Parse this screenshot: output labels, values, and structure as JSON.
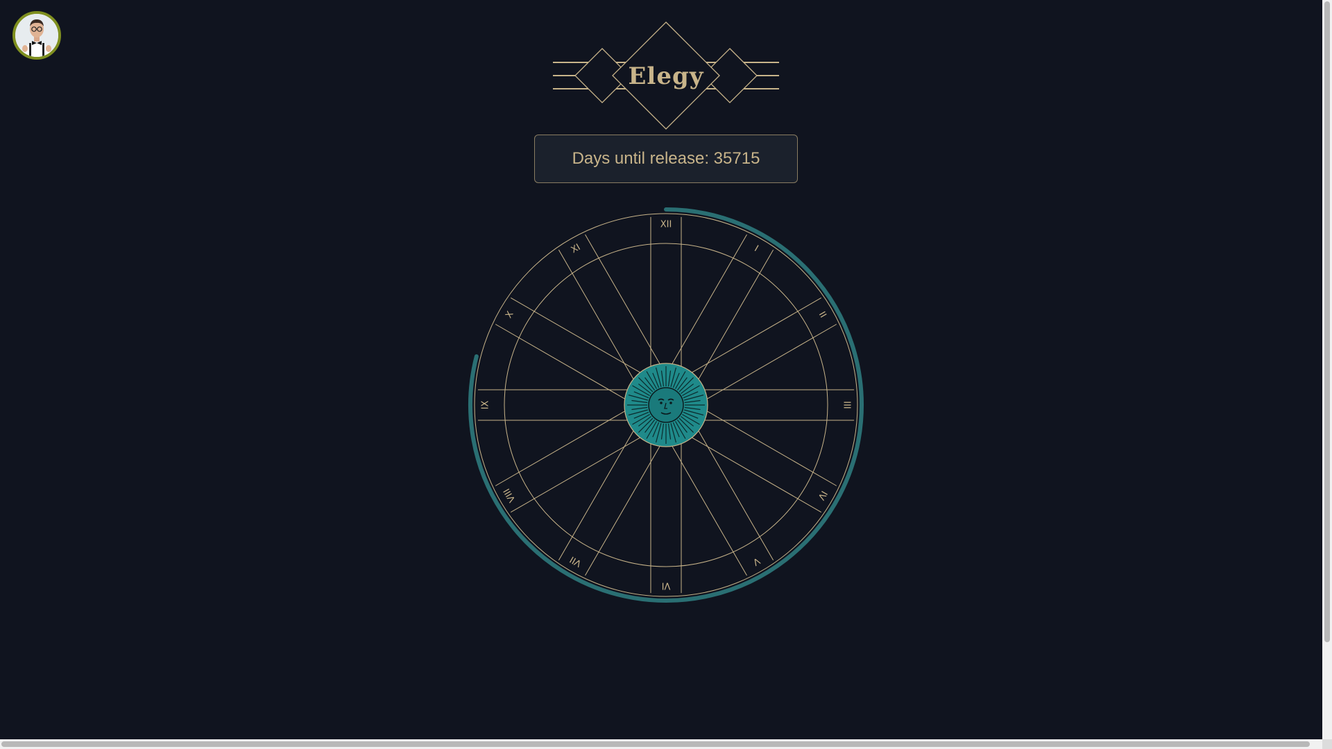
{
  "app": {
    "title": "Elegy"
  },
  "user": {
    "avatar_icon": "user-avatar-photo"
  },
  "countdown": {
    "label": "Days until release: 35715"
  },
  "clock": {
    "numerals": [
      "XII",
      "I",
      "II",
      "III",
      "IV",
      "V",
      "VI",
      "VII",
      "VIII",
      "IX",
      "X",
      "XI"
    ],
    "progress_fraction": 0.79,
    "center_icon": "sun-face-icon"
  },
  "colors": {
    "background": "#10141f",
    "gold": "#c8b48a",
    "teal": "#1f8a8a",
    "progress": "#2a6f73",
    "avatar_ring": "#7f8f1f"
  }
}
